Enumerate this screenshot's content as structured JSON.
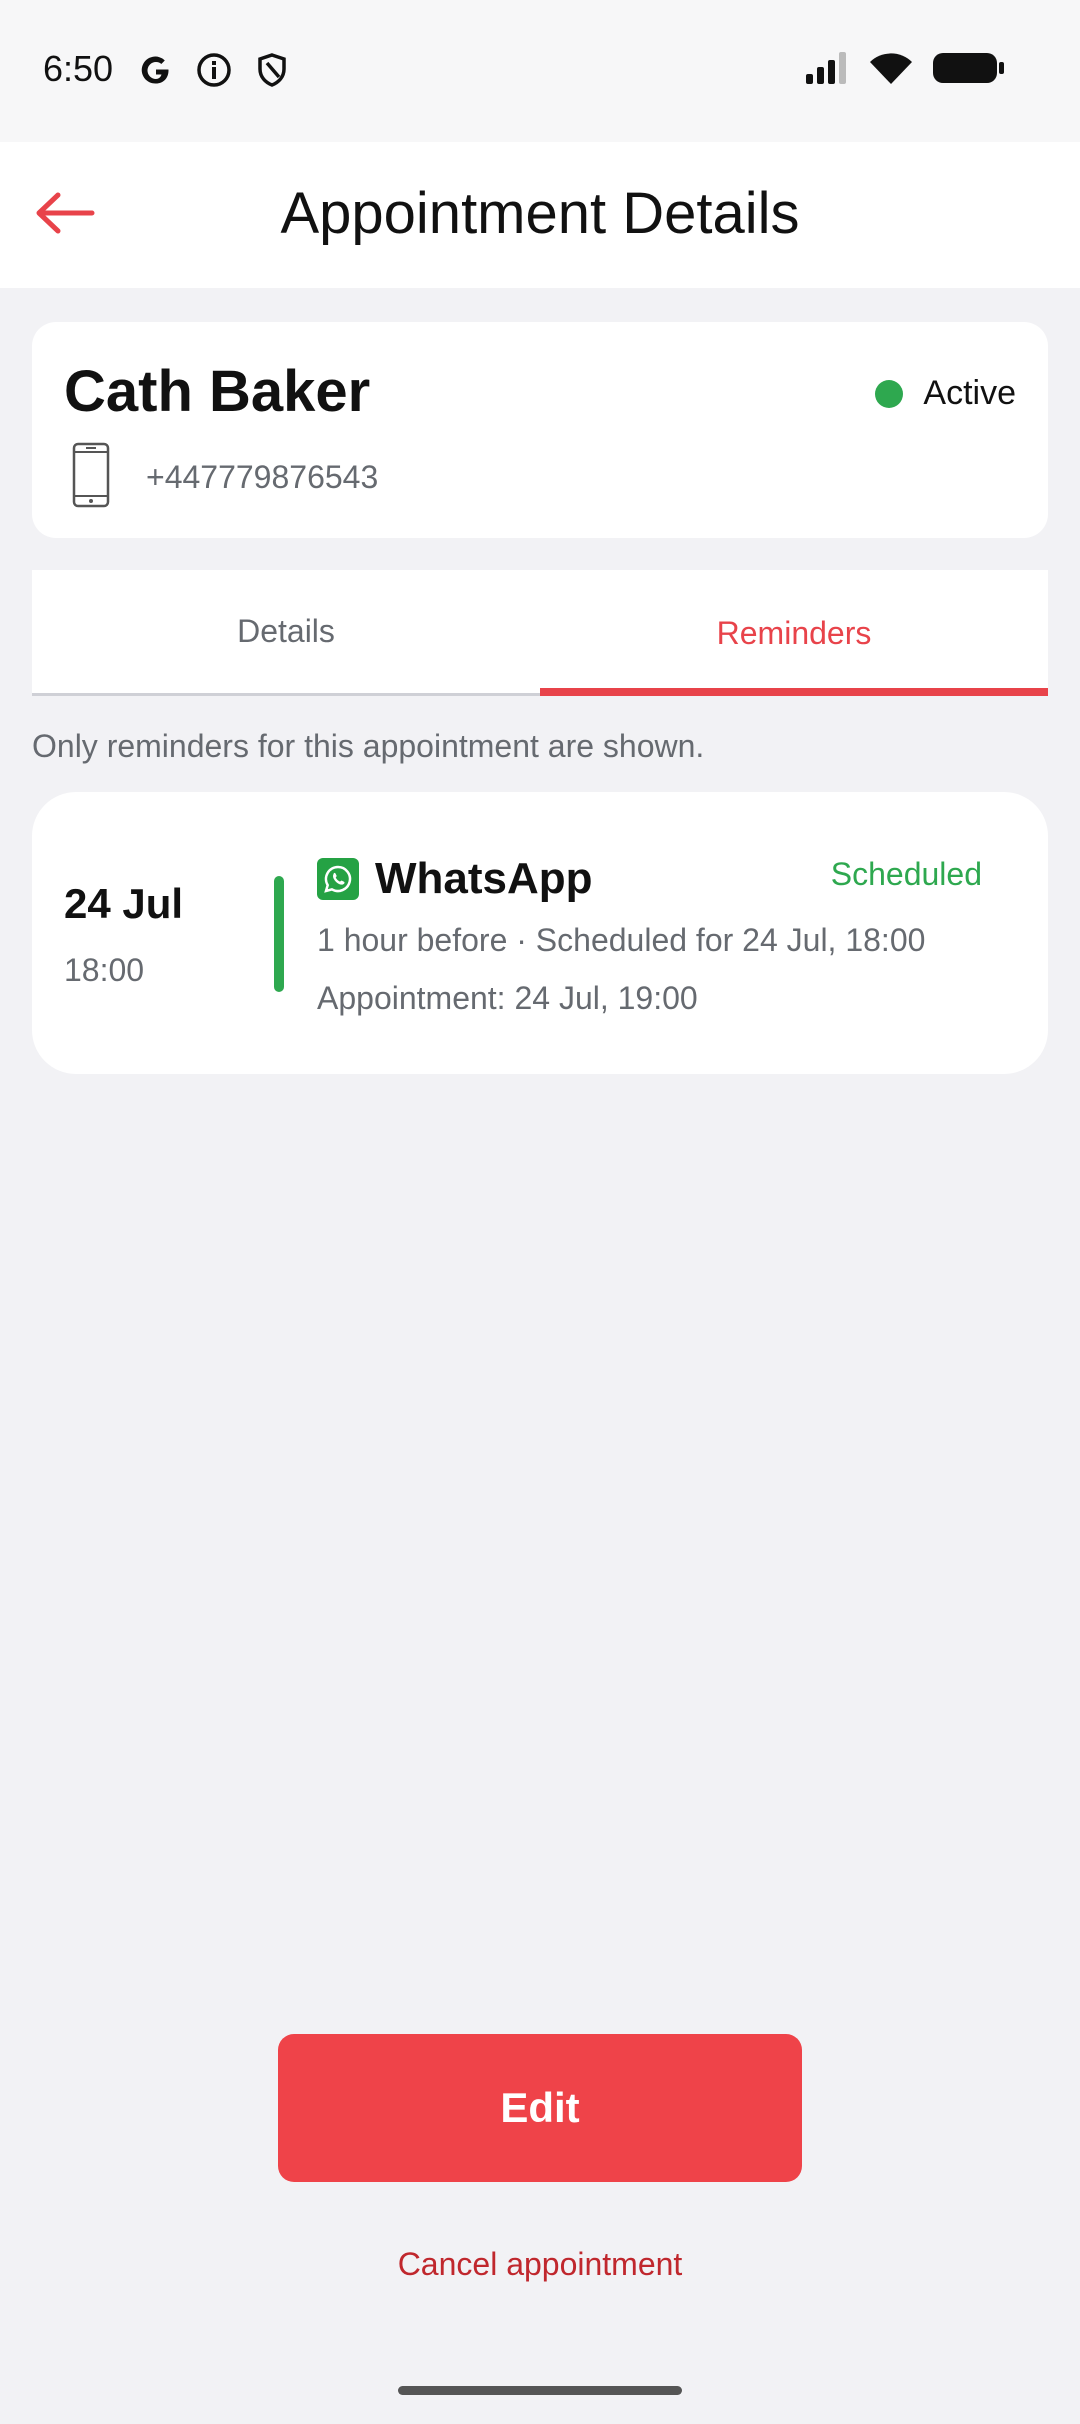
{
  "status_bar": {
    "time": "6:50",
    "left_icons": [
      "google-icon",
      "info-icon",
      "shield-icon"
    ],
    "right_icons": [
      "signal-icon",
      "wifi-icon",
      "battery-icon"
    ]
  },
  "header": {
    "title": "Appointment Details",
    "back_icon": "arrow-left-icon"
  },
  "client": {
    "name": "Cath Baker",
    "status": "Active",
    "status_color": "#2ea84f",
    "phone": "+447779876543",
    "phone_icon": "smartphone-icon"
  },
  "tabs": [
    {
      "label": "Details",
      "selected": false
    },
    {
      "label": "Reminders",
      "selected": true
    }
  ],
  "note": "Only reminders for this appointment are shown.",
  "reminders": [
    {
      "date": "24 Jul",
      "time": "18:00",
      "channel": "WhatsApp",
      "channel_icon": "whatsapp-icon",
      "status": "Scheduled",
      "detail": "1 hour before · Scheduled for 24 Jul, 18:00",
      "appointment": "Appointment: 24 Jul, 19:00"
    }
  ],
  "actions": {
    "edit_label": "Edit",
    "cancel_label": "Cancel appointment"
  },
  "colors": {
    "accent": "#ef4349",
    "success": "#2ea84f",
    "background": "#f2f2f5"
  }
}
